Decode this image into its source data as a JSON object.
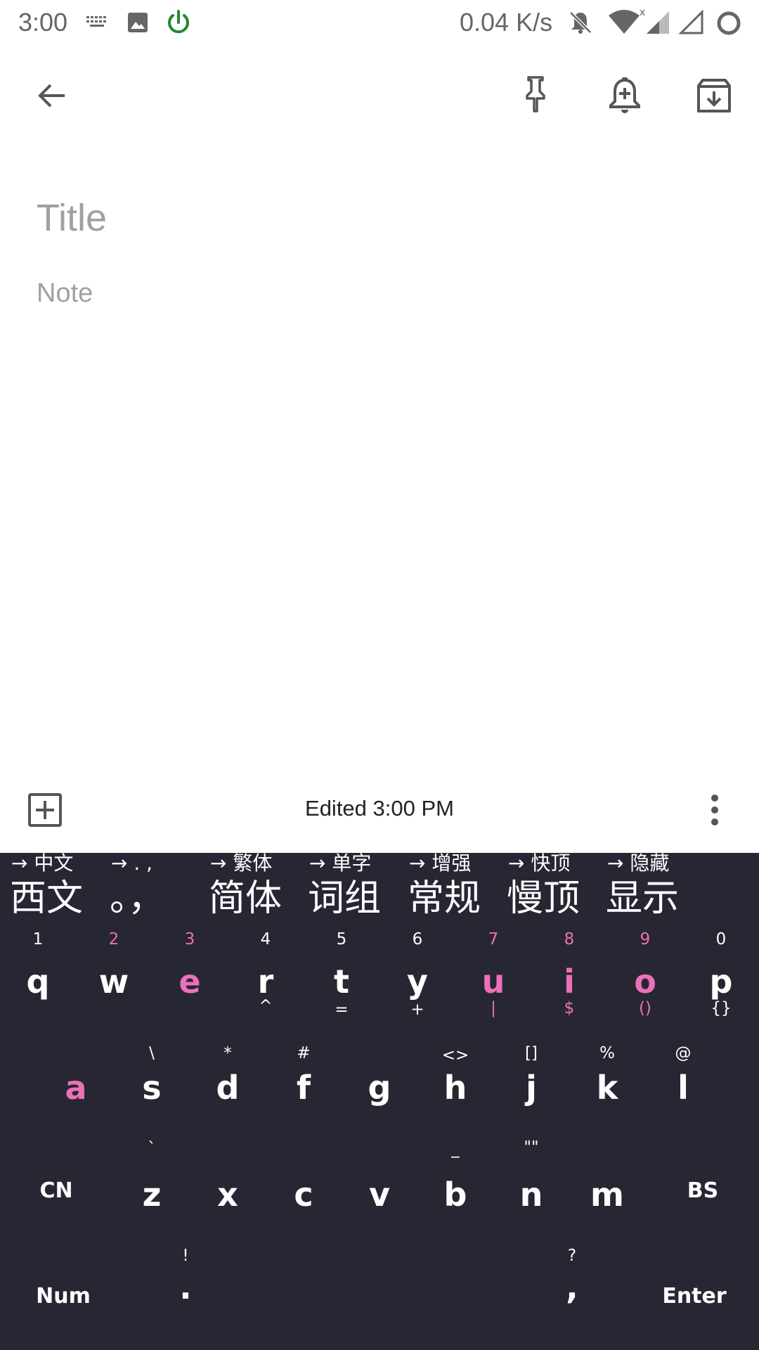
{
  "status_bar": {
    "time": "3:00",
    "speed": "0.04 K/s",
    "icons": [
      "keyboard-icon",
      "image-icon",
      "power-icon",
      "notifications-off-icon",
      "wifi-icon",
      "signal-icon",
      "signal-empty-icon",
      "circle-icon"
    ],
    "power_color": "#1e8a2e"
  },
  "toolbar": {
    "icons": [
      "back-arrow-icon",
      "pin-icon",
      "reminder-icon",
      "archive-icon"
    ]
  },
  "note": {
    "title_placeholder": "Title",
    "note_placeholder": "Note"
  },
  "bottom_bar": {
    "edited": "Edited 3:00 PM",
    "icons": [
      "add-box-icon",
      "more-vert-icon"
    ]
  },
  "keyboard": {
    "colors": {
      "background": "#262733",
      "text": "#ffffff",
      "accent": "#ee6fb9"
    },
    "toggles": [
      {
        "hint": "→ 中文",
        "label": "西文"
      },
      {
        "hint": "→ . ,",
        "label": "。，"
      },
      {
        "hint": "→ 繁体",
        "label": "简体"
      },
      {
        "hint": "→ 单字",
        "label": "词组"
      },
      {
        "hint": "→ 增强",
        "label": "常规"
      },
      {
        "hint": "→ 快顶",
        "label": "慢顶"
      },
      {
        "hint": "→ 隐藏",
        "label": "显示"
      }
    ],
    "row1": [
      {
        "num": "1",
        "key": "q",
        "sub": ""
      },
      {
        "num": "2",
        "key": "w",
        "sub": ""
      },
      {
        "num": "3",
        "key": "e",
        "sub": ""
      },
      {
        "num": "4",
        "key": "r",
        "sub": "^"
      },
      {
        "num": "5",
        "key": "t",
        "sub": "="
      },
      {
        "num": "6",
        "key": "y",
        "sub": "+"
      },
      {
        "num": "7",
        "key": "u",
        "sub": "|"
      },
      {
        "num": "8",
        "key": "i",
        "sub": "$"
      },
      {
        "num": "9",
        "key": "o",
        "sub": "()"
      },
      {
        "num": "0",
        "key": "p",
        "sub": "{}"
      }
    ],
    "row2": [
      {
        "sym": "",
        "key": "a",
        "sub": ""
      },
      {
        "sym": "\\",
        "key": "s",
        "sub": "`"
      },
      {
        "sym": "*",
        "key": "d",
        "sub": ""
      },
      {
        "sym": "#",
        "key": "f",
        "sub": ""
      },
      {
        "sym": "",
        "key": "g",
        "sub": ""
      },
      {
        "sym": "<>",
        "key": "h",
        "sub": "_"
      },
      {
        "sym": "[]",
        "key": "j",
        "sub": "\"\""
      },
      {
        "sym": "%",
        "key": "k",
        "sub": ""
      },
      {
        "sym": "@",
        "key": "l",
        "sub": ""
      }
    ],
    "row3": [
      {
        "key": "CN"
      },
      {
        "key": "z"
      },
      {
        "key": "x"
      },
      {
        "key": "c"
      },
      {
        "key": "v"
      },
      {
        "key": "b"
      },
      {
        "key": "n"
      },
      {
        "key": "m"
      },
      {
        "key": "BS"
      }
    ],
    "row4": {
      "num": "Num",
      "period_sym": "!",
      "period": ".",
      "comma_sym": "?",
      "comma": ",",
      "enter": "Enter"
    }
  }
}
